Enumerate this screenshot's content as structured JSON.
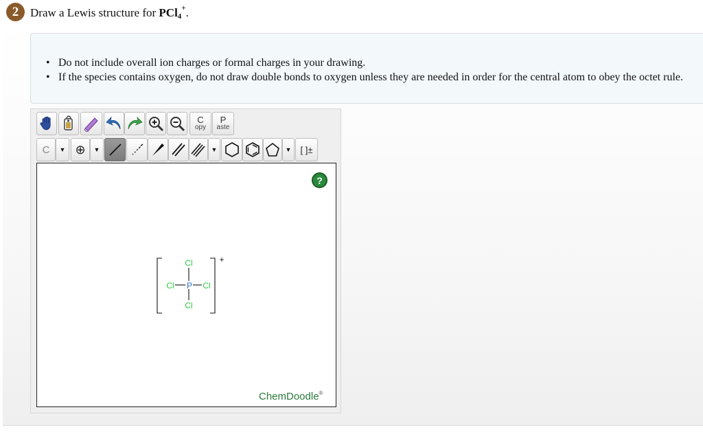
{
  "question": {
    "number": "2",
    "prefix": "Draw a Lewis structure for ",
    "formula_main": "PCl",
    "formula_sub": "4",
    "formula_sup": "+",
    "suffix": "."
  },
  "instructions": [
    "Do not include overall ion charges or formal charges in your drawing.",
    "If the species contains oxygen, do not draw double bonds to oxygen unless they are needed in order for the central atom to obey the octet rule."
  ],
  "toolbar": {
    "copy_big": "C",
    "copy_small": "opy",
    "paste_big": "P",
    "paste_small": "aste",
    "element_label": "C",
    "dropdown_glyph": "▼",
    "charge_glyph": "⊕",
    "bracket_label": "[ ]±"
  },
  "icons": {
    "hand": "hand-icon",
    "lasso": "lasso-icon",
    "eraser": "eraser-icon",
    "undo": "undo-icon",
    "redo": "redo-icon",
    "zoom_in": "zoom-in-icon",
    "zoom_out": "zoom-out-icon"
  },
  "canvas": {
    "help_glyph": "?",
    "brand": "ChemDoodle",
    "brand_mark": "®"
  },
  "molecule": {
    "central": "P",
    "ligands": [
      "Cl",
      "Cl",
      "Cl",
      "Cl"
    ],
    "charge": "+",
    "colors": {
      "P": "#2b6fd6",
      "Cl": "#2ecc40",
      "bond": "#111111"
    }
  }
}
